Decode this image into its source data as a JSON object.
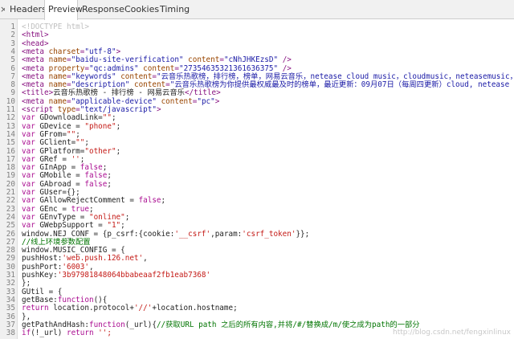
{
  "tabs": {
    "close": "×",
    "headers": "Headers",
    "preview": "Preview",
    "response": "Response",
    "cookies": "Cookies",
    "timing": "Timing"
  },
  "colors": {
    "doctype": "#c0c0c0",
    "tag": "#881280",
    "attr": "#994500",
    "value": "#1a1aa6",
    "text": "#222222",
    "keyword": "#aa0d91",
    "string": "#c41a16",
    "comment": "#007400"
  },
  "code_lines": [
    [
      [
        "doctype",
        "<!DOCTYPE html>"
      ]
    ],
    [
      [
        "tag",
        "<html>"
      ]
    ],
    [
      [
        "tag",
        "<head>"
      ]
    ],
    [
      [
        "tag",
        "<meta "
      ],
      [
        "attr",
        "charset"
      ],
      [
        "tag",
        "="
      ],
      [
        "value",
        "\"utf-8\""
      ],
      [
        "tag",
        ">"
      ]
    ],
    [
      [
        "tag",
        "<meta "
      ],
      [
        "attr",
        "name"
      ],
      [
        "tag",
        "="
      ],
      [
        "value",
        "\"baidu-site-verification\""
      ],
      [
        "tag",
        " "
      ],
      [
        "attr",
        "content"
      ],
      [
        "tag",
        "="
      ],
      [
        "value",
        "\"cNhJHKEzsD\""
      ],
      [
        "tag",
        " />"
      ]
    ],
    [
      [
        "tag",
        "<meta "
      ],
      [
        "attr",
        "property"
      ],
      [
        "tag",
        "="
      ],
      [
        "value",
        "\"qc:admins\""
      ],
      [
        "tag",
        " "
      ],
      [
        "attr",
        "content"
      ],
      [
        "tag",
        "="
      ],
      [
        "value",
        "\"27354635321361636375\""
      ],
      [
        "tag",
        " />"
      ]
    ],
    [
      [
        "tag",
        "<meta "
      ],
      [
        "attr",
        "name"
      ],
      [
        "tag",
        "="
      ],
      [
        "value",
        "\"keywords\""
      ],
      [
        "tag",
        " "
      ],
      [
        "attr",
        "content"
      ],
      [
        "tag",
        "="
      ],
      [
        "value",
        "\"云音乐热歌榜，排行榜，榜单，网易云音乐，netease cloud music，cloudmusic，neteasemusic，n"
      ]
    ],
    [
      [
        "tag",
        "<meta "
      ],
      [
        "attr",
        "name"
      ],
      [
        "tag",
        "="
      ],
      [
        "value",
        "\"description\""
      ],
      [
        "tag",
        " "
      ],
      [
        "attr",
        "content"
      ],
      [
        "tag",
        "="
      ],
      [
        "value",
        "\"云音乐热歌榜为你提供最权威最及时的榜单，最近更新：09月07日（每周四更新）cloud, netease clo"
      ]
    ],
    [
      [
        "tag",
        "<title>"
      ],
      [
        "text",
        "云音乐热歌榜 - 排行榜 - 网易云音乐"
      ],
      [
        "tag",
        "</title>"
      ]
    ],
    [
      [
        "tag",
        "<meta "
      ],
      [
        "attr",
        "name"
      ],
      [
        "tag",
        "="
      ],
      [
        "value",
        "\"applicable-device\""
      ],
      [
        "tag",
        " "
      ],
      [
        "attr",
        "content"
      ],
      [
        "tag",
        "="
      ],
      [
        "value",
        "\"pc\""
      ],
      [
        "tag",
        ">"
      ]
    ],
    [
      [
        "tag",
        "<script "
      ],
      [
        "attr",
        "type"
      ],
      [
        "tag",
        "="
      ],
      [
        "value",
        "\"text/javascript\""
      ],
      [
        "tag",
        ">"
      ]
    ],
    [
      [
        "keyword",
        "var "
      ],
      [
        "text",
        "GDownloadLink="
      ],
      [
        "string",
        "\"\""
      ],
      [
        "text",
        ";"
      ]
    ],
    [
      [
        "keyword",
        "var "
      ],
      [
        "text",
        "GDevice = "
      ],
      [
        "string",
        "\"phone\""
      ],
      [
        "text",
        ";"
      ]
    ],
    [
      [
        "keyword",
        "var "
      ],
      [
        "text",
        "GFrom="
      ],
      [
        "string",
        "\"\""
      ],
      [
        "text",
        ";"
      ]
    ],
    [
      [
        "keyword",
        "var "
      ],
      [
        "text",
        "GClient="
      ],
      [
        "string",
        "\"\""
      ],
      [
        "text",
        ";"
      ]
    ],
    [
      [
        "keyword",
        "var "
      ],
      [
        "text",
        "GPlatform="
      ],
      [
        "string",
        "\"other\""
      ],
      [
        "text",
        ";"
      ]
    ],
    [
      [
        "keyword",
        "var "
      ],
      [
        "text",
        "GRef = "
      ],
      [
        "string",
        "''"
      ],
      [
        "text",
        ";"
      ]
    ],
    [
      [
        "keyword",
        "var "
      ],
      [
        "text",
        "GInApp = "
      ],
      [
        "keyword",
        "false"
      ],
      [
        "text",
        ";"
      ]
    ],
    [
      [
        "keyword",
        "var "
      ],
      [
        "text",
        "GMobile = "
      ],
      [
        "keyword",
        "false"
      ],
      [
        "text",
        ";"
      ]
    ],
    [
      [
        "keyword",
        "var "
      ],
      [
        "text",
        "GAbroad = "
      ],
      [
        "keyword",
        "false"
      ],
      [
        "text",
        ";"
      ]
    ],
    [
      [
        "keyword",
        "var "
      ],
      [
        "text",
        "GUser={};"
      ]
    ],
    [
      [
        "keyword",
        "var "
      ],
      [
        "text",
        "GAllowRejectComment = "
      ],
      [
        "keyword",
        "false"
      ],
      [
        "text",
        ";"
      ]
    ],
    [
      [
        "keyword",
        "var "
      ],
      [
        "text",
        "GEnc = "
      ],
      [
        "keyword",
        "true"
      ],
      [
        "text",
        ";"
      ]
    ],
    [
      [
        "keyword",
        "var "
      ],
      [
        "text",
        "GEnvType = "
      ],
      [
        "string",
        "\"online\""
      ],
      [
        "text",
        ";"
      ]
    ],
    [
      [
        "keyword",
        "var "
      ],
      [
        "text",
        "GWebpSupport = "
      ],
      [
        "string",
        "\"1\""
      ],
      [
        "text",
        ";"
      ]
    ],
    [
      [
        "text",
        "window.NEJ_CONF = {p_csrf:{cookie:"
      ],
      [
        "string",
        "'__csrf'"
      ],
      [
        "text",
        ",param:"
      ],
      [
        "string",
        "'csrf_token'"
      ],
      [
        "text",
        "}};"
      ]
    ],
    [
      [
        "comment",
        "//线上环境参数配置"
      ]
    ],
    [
      [
        "text",
        "window.MUSIC_CONFIG = {"
      ]
    ],
    [
      [
        "text",
        "pushHost:"
      ],
      [
        "string",
        "'web.push.126.net'"
      ],
      [
        "text",
        ","
      ]
    ],
    [
      [
        "text",
        "pushPort:"
      ],
      [
        "string",
        "'6003'"
      ],
      [
        "text",
        ","
      ]
    ],
    [
      [
        "text",
        "pushKey:"
      ],
      [
        "string",
        "'3b97981848064bbabeaaf2fb1eab7368'"
      ]
    ],
    [
      [
        "text",
        "};"
      ]
    ],
    [
      [
        "text",
        "GUtil = {"
      ]
    ],
    [
      [
        "text",
        "getBase:"
      ],
      [
        "keyword",
        "function"
      ],
      [
        "text",
        "(){"
      ]
    ],
    [
      [
        "keyword",
        "return "
      ],
      [
        "text",
        "location.protocol+"
      ],
      [
        "string",
        "'//'"
      ],
      [
        "text",
        "+location.hostname;"
      ]
    ],
    [
      [
        "text",
        "},"
      ]
    ],
    [
      [
        "text",
        "getPathAndHash:"
      ],
      [
        "keyword",
        "function"
      ],
      [
        "text",
        "(_url){"
      ],
      [
        "comment",
        "//获取URL path 之后的所有内容,并将/#/替换成/m/使之成为path的一部分"
      ]
    ],
    [
      [
        "keyword",
        "if"
      ],
      [
        "text",
        "(!_url) "
      ],
      [
        "keyword",
        "return "
      ],
      [
        "string",
        "'';"
      ]
    ]
  ],
  "watermark": "http://blog.csdn.net/fengxinlinux"
}
